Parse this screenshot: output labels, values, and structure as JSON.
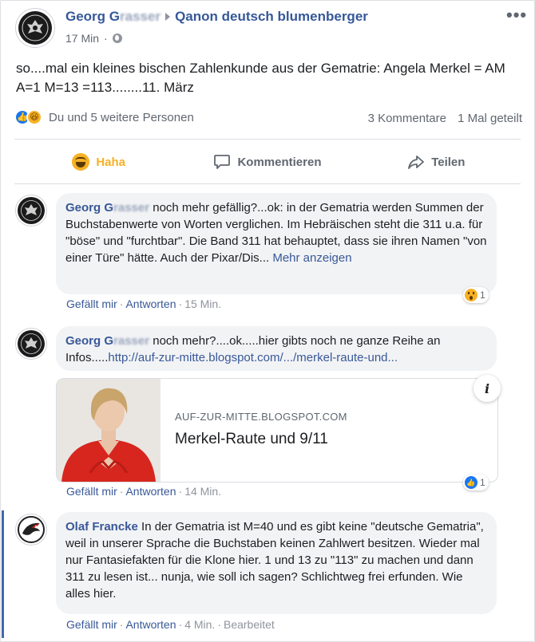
{
  "post": {
    "author_visible": "Georg G",
    "author_blurred": "rasser",
    "group": "Qanon deutsch blumenberger",
    "time": "17 Min",
    "text": "so....mal ein kleines bischen Zahlenkunde aus der Gematrie: Angela Merkel = AM A=1 M=13 =113........11. März",
    "reactions_text": "Du und 5 weitere Personen",
    "comments_count": "3 Kommentare",
    "shares_count": "1 Mal geteilt",
    "icons": [
      "globe-icon",
      "like-icon",
      "haha-icon",
      "more-icon"
    ]
  },
  "actions": {
    "haha": "Haha",
    "comment": "Kommentieren",
    "share": "Teilen"
  },
  "comments": [
    {
      "author_visible": "Georg G",
      "author_blurred": "rasser",
      "text": " noch mehr gefällig?...ok: in der Gematria werden Summen der Buchstabenwerte von Worten verglichen. Im Hebräischen steht die 311 u.a. für \"böse\" und \"furchtbar\". Die Band 311 hat behauptet, dass sie ihren Namen \"von einer Türe\" hätte. Auch der Pixar/Dis...",
      "see_more": "Mehr anzeigen",
      "like": "Gefällt mir",
      "reply": "Antworten",
      "time": "15 Min.",
      "reaction_count": "1"
    },
    {
      "author_visible": "Georg G",
      "author_blurred": "rasser",
      "text": " noch mehr?....ok.....hier gibts noch ne ganze Reihe an Infos.....",
      "link": "http://auf-zur-mitte.blogspot.com/.../merkel-raute-und...",
      "card_domain": "AUF-ZUR-MITTE.BLOGSPOT.COM",
      "card_title": "Merkel-Raute und 9/11",
      "info": "i",
      "like": "Gefällt mir",
      "reply": "Antworten",
      "time": "14 Min.",
      "reaction_count": "1"
    },
    {
      "author": "Olaf Francke",
      "text": " In der Gematria ist M=40 und es gibt keine \"deutsche Gematria\", weil in unserer Sprache die Buchstaben keinen Zahlwert besitzen. Wieder mal nur Fantasiefakten für die Klone hier. 1 und 13 zu \"113\" zu machen und dann 311 zu lesen ist... nunja, wie soll ich sagen? Schlichtweg frei erfunden. Wie alles hier.",
      "like": "Gefällt mir",
      "reply": "Antworten",
      "time": "4 Min.",
      "edited": "Bearbeitet"
    }
  ],
  "sep": "·",
  "colors": {
    "link": "#385898",
    "haha": "#f7b125",
    "like": "#1877f2",
    "thread": "#4267b2"
  }
}
